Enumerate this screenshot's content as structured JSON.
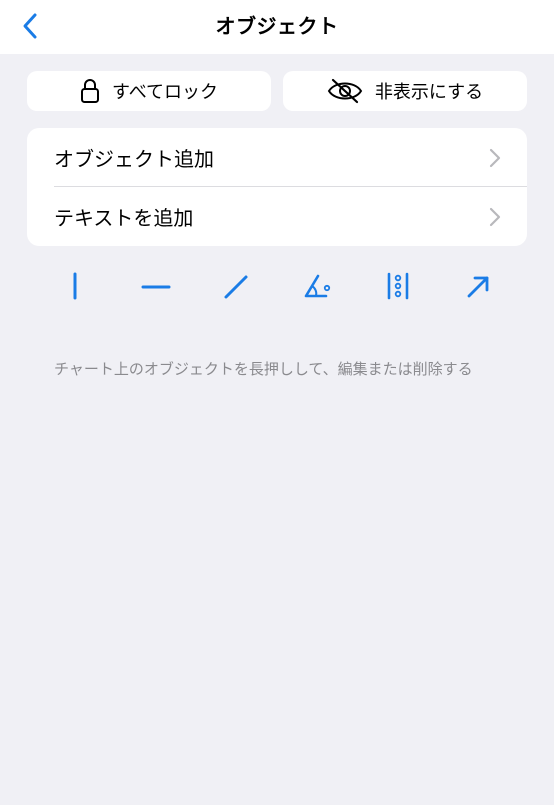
{
  "header": {
    "title": "オブジェクト",
    "back_icon": "chevron-left-icon"
  },
  "actions": {
    "lock_all_label": "すべてロック",
    "hide_label": "非表示にする"
  },
  "menu": {
    "items": [
      {
        "label": "オブジェクト追加"
      },
      {
        "label": "テキストを追加"
      }
    ]
  },
  "tools": [
    {
      "name": "vertical-line-tool-icon"
    },
    {
      "name": "horizontal-line-tool-icon"
    },
    {
      "name": "trend-line-tool-icon"
    },
    {
      "name": "angle-tool-icon"
    },
    {
      "name": "fibonacci-tool-icon"
    },
    {
      "name": "arrow-tool-icon"
    }
  ],
  "hint": "チャート上のオブジェクトを長押しして、編集または削除する",
  "colors": {
    "accent": "#1a7ce6",
    "background": "#f0f0f5",
    "chevron": "#b8b8bc",
    "hint": "#8a8a8e"
  }
}
